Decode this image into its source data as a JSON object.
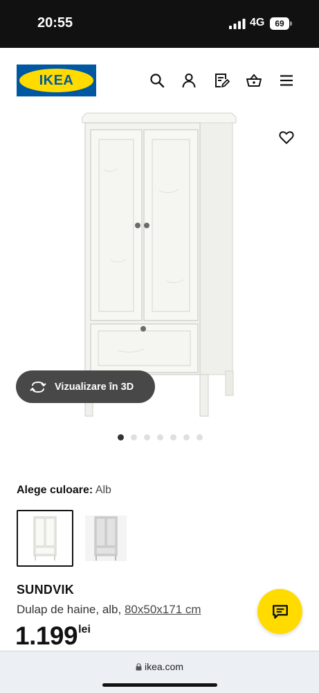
{
  "status_bar": {
    "time": "20:55",
    "network": "4G",
    "battery": "69"
  },
  "header": {
    "logo_text": "IKEA",
    "icons": [
      "search-icon",
      "user-icon",
      "shopping-list-icon",
      "basket-icon",
      "menu-icon"
    ]
  },
  "gallery": {
    "view_3d_label": "Vizualizare în 3D",
    "image_count": 7,
    "active_index": 0
  },
  "color_choice": {
    "label": "Alege culoare:",
    "value": "Alb",
    "options": [
      "white",
      "grey"
    ]
  },
  "product": {
    "name": "SUNDVIK",
    "description": "Dulap de haine, alb,",
    "size": "80x50x171 cm",
    "price_int": "1.199",
    "price_currency": "lei"
  },
  "browser": {
    "url": "ikea.com"
  },
  "colors": {
    "ikea_blue": "#0058a3",
    "ikea_yellow": "#ffdb00",
    "dark_pill": "#484848"
  }
}
